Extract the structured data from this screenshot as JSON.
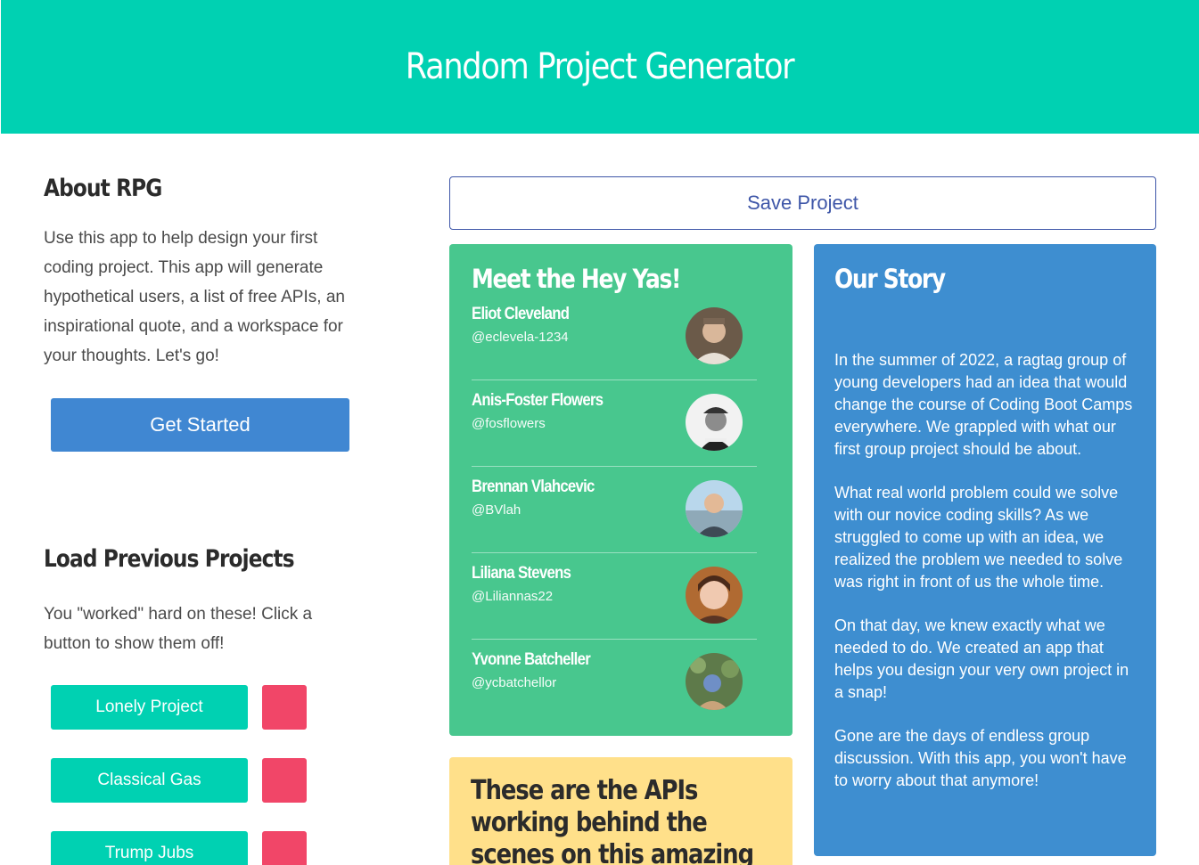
{
  "header": {
    "title": "Random Project Generator"
  },
  "about": {
    "title": "About RPG",
    "text": "Use this app to help design your first coding project. This app will generate hypothetical users, a list of free APIs, an inspirational quote, and a workspace for your thoughts. Let's go!",
    "start_button": "Get Started"
  },
  "load": {
    "title": "Load Previous Projects",
    "text": "You \"worked\" hard on these! Click a button to show them off!",
    "projects": [
      {
        "label": "Lonely Project"
      },
      {
        "label": "Classical Gas"
      },
      {
        "label": "Trump Jubs"
      }
    ]
  },
  "save_button": "Save Project",
  "team": {
    "title": "Meet the Hey Yas!",
    "members": [
      {
        "name": "Eliot Cleveland",
        "handle": "@eclevela-1234"
      },
      {
        "name": "Anis-Foster Flowers",
        "handle": "@fosflowers"
      },
      {
        "name": "Brennan Vlahcevic",
        "handle": "@BVlah"
      },
      {
        "name": "Liliana Stevens",
        "handle": "@Liliannas22"
      },
      {
        "name": "Yvonne Batcheller",
        "handle": "@ycbatchellor"
      }
    ]
  },
  "apis": {
    "title": "These are the APIs working behind the scenes on this amazing"
  },
  "story": {
    "title": "Our Story",
    "paragraphs": [
      "In the summer of 2022, a ragtag group of young developers had an idea that would change the course of Coding Boot Camps everywhere. We grappled with what our first group project should be about.",
      "What real world problem could we solve with our novice coding skills? As we struggled to come up with an idea, we realized the problem we needed to solve was right in front of us the whole time.",
      "On that day, we knew exactly what we needed to do. We created an app that helps you design your very own project in a snap!",
      "Gone are the days of endless group discussion. With this app, you won't have to worry about that anymore!"
    ]
  },
  "colors": {
    "primary": "#00d1b2",
    "info": "#3e8ed0",
    "success": "#48c78e",
    "warning": "#ffe08a",
    "danger": "#f14668",
    "link": "#4087d2"
  }
}
